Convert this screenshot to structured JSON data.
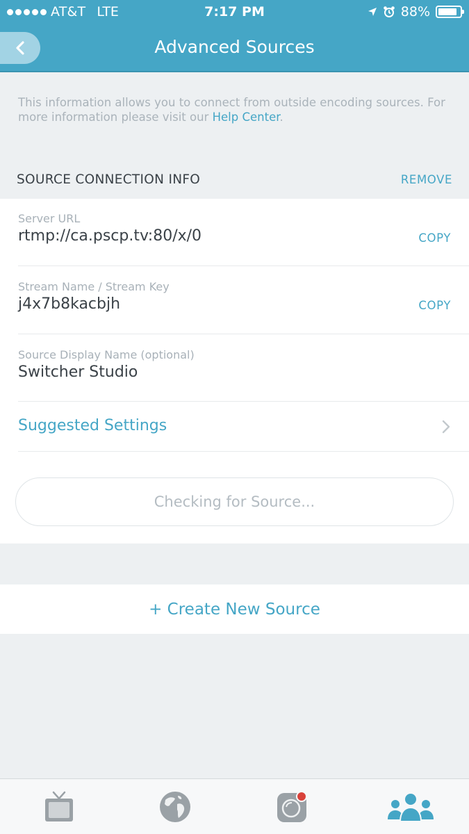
{
  "status_bar": {
    "carrier": "AT&T",
    "network": "LTE",
    "time": "7:17 PM",
    "battery": "88%",
    "battery_level": 0.88
  },
  "nav": {
    "title": "Advanced Sources",
    "back_icon": "chevron-left-icon"
  },
  "intro": {
    "text": "This information allows you to connect from outside encoding sources. For more information please visit our ",
    "link": "Help Center",
    "suffix": "."
  },
  "section": {
    "title": "SOURCE CONNECTION INFO",
    "remove_label": "REMOVE"
  },
  "fields": {
    "server_url": {
      "label": "Server URL",
      "value": "rtmp://ca.pscp.tv:80/x/0",
      "copy": "COPY"
    },
    "stream_key": {
      "label": "Stream Name / Stream Key",
      "value": "j4x7b8kacbjh",
      "copy": "COPY"
    },
    "display_name": {
      "label": "Source Display Name (optional)",
      "value": "Switcher Studio"
    }
  },
  "suggested": {
    "label": "Suggested Settings"
  },
  "checking": {
    "label": "Checking for Source..."
  },
  "create": {
    "label": "+ Create New Source"
  },
  "tabs": [
    {
      "icon": "tv-icon"
    },
    {
      "icon": "globe-icon"
    },
    {
      "icon": "broadcast-camera-icon"
    },
    {
      "icon": "people-icon"
    }
  ],
  "colors": {
    "accent": "#45a6c6",
    "header": "#45a6c6",
    "background": "#edf0f2"
  }
}
